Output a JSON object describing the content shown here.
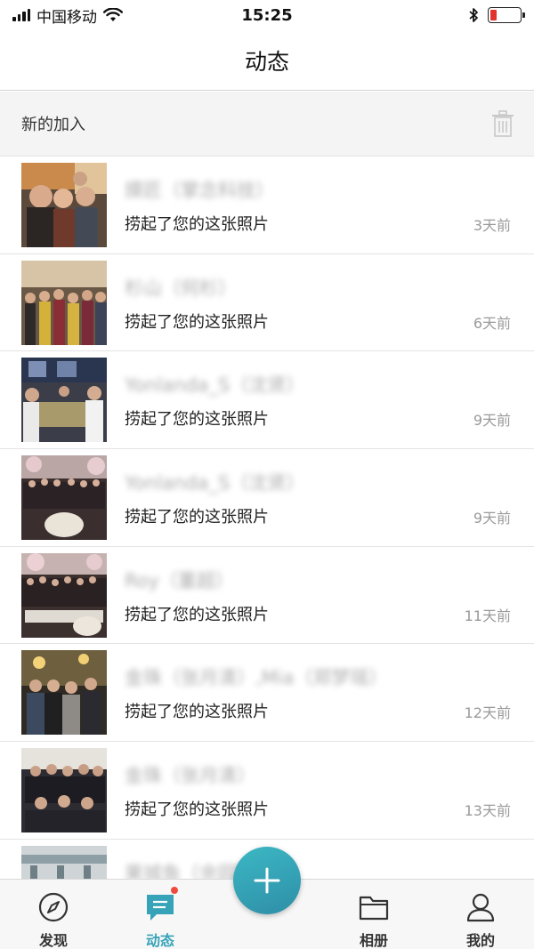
{
  "status_bar": {
    "carrier": "中国移动",
    "time": "15:25",
    "battery_color": "#e0332e"
  },
  "nav": {
    "title": "动态"
  },
  "section": {
    "title": "新的加入",
    "trash_icon": "trash-icon"
  },
  "feed": [
    {
      "name": "摸匠（掌念科技）",
      "action": "捞起了您的这张照片",
      "time": "3天前"
    },
    {
      "name": "杉山（何杉）",
      "action": "捞起了您的这张照片",
      "time": "6天前"
    },
    {
      "name": "Yonlanda_S（沈贤）",
      "action": "捞起了您的这张照片",
      "time": "9天前"
    },
    {
      "name": "Yonlanda_S（沈贤）",
      "action": "捞起了您的这张照片",
      "time": "9天前"
    },
    {
      "name": "Roy（董超）",
      "action": "捞起了您的这张照片",
      "time": "11天前"
    },
    {
      "name": "金珠（张月清）,Mia（郑梦瑶）",
      "action": "捞起了您的这张照片",
      "time": "12天前"
    },
    {
      "name": "金珠（张月清）",
      "action": "捞起了您的这张照片",
      "time": "13天前"
    },
    {
      "name": "果城鱼（余园园）",
      "action": "",
      "time": ""
    }
  ],
  "tabs": {
    "discover": "发现",
    "activity": "动态",
    "album": "相册",
    "mine": "我的"
  },
  "accent_color": "#36a3b8"
}
